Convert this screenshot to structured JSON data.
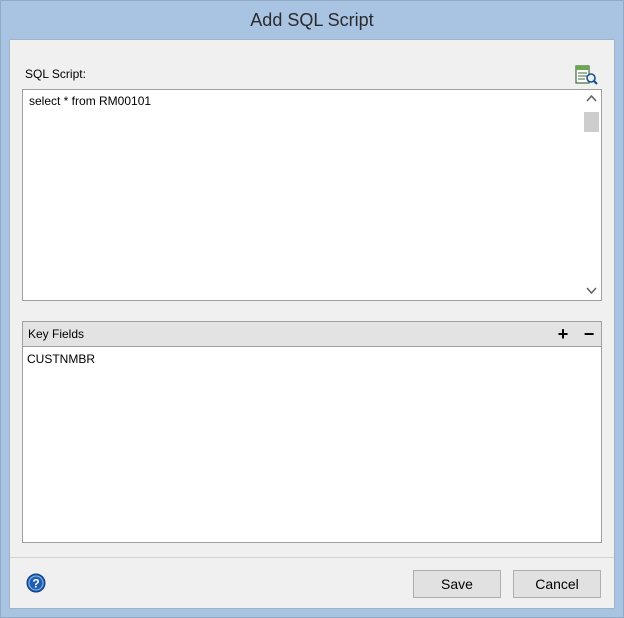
{
  "window": {
    "title": "Add SQL Script"
  },
  "sql": {
    "label": "SQL Script:",
    "text": "select * from RM00101",
    "viewer_icon": "query-viewer-icon"
  },
  "key_fields": {
    "title": "Key Fields",
    "add_label": "+",
    "remove_label": "−",
    "rows": [
      "CUSTNMBR"
    ]
  },
  "footer": {
    "help_icon": "help-icon",
    "save_label": "Save",
    "cancel_label": "Cancel"
  },
  "colors": {
    "title_bar": "#a9c3e3",
    "client_bg": "#f0f0f0",
    "help_blue": "#1e5fb4"
  }
}
